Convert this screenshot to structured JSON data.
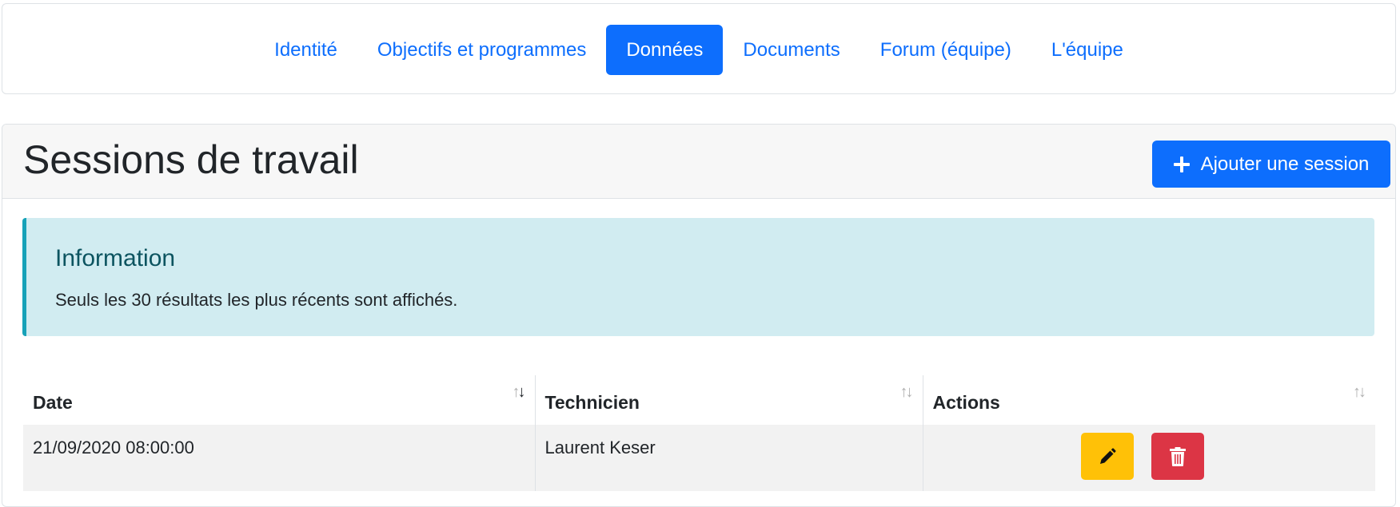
{
  "nav": {
    "tabs": [
      {
        "label": "Identité"
      },
      {
        "label": "Objectifs et programmes"
      },
      {
        "label": "Données"
      },
      {
        "label": "Documents"
      },
      {
        "label": "Forum (équipe)"
      },
      {
        "label": "L'équipe"
      }
    ],
    "active_tab": "Données"
  },
  "header": {
    "title": "Sessions de travail",
    "add_button_label": "Ajouter une session",
    "add_icon": "plus-icon"
  },
  "alert": {
    "heading": "Information",
    "text": "Seuls les 30 résultats les plus récents sont affichés."
  },
  "table": {
    "columns": [
      {
        "label": "Date",
        "sort": "descending"
      },
      {
        "label": "Technicien",
        "sort": "none"
      },
      {
        "label": "Actions",
        "sort": "none"
      }
    ],
    "rows": [
      {
        "date": "21/09/2020 08:00:00",
        "technician": "Laurent Keser",
        "actions": [
          "pencil-icon",
          "trash-icon"
        ]
      }
    ]
  },
  "colors": {
    "primary": "#0d6efd",
    "info_bg": "#d1ecf1",
    "info_border": "#17a2b8",
    "info_heading": "#0c5460",
    "warning": "#ffc107",
    "danger": "#dc3545"
  }
}
